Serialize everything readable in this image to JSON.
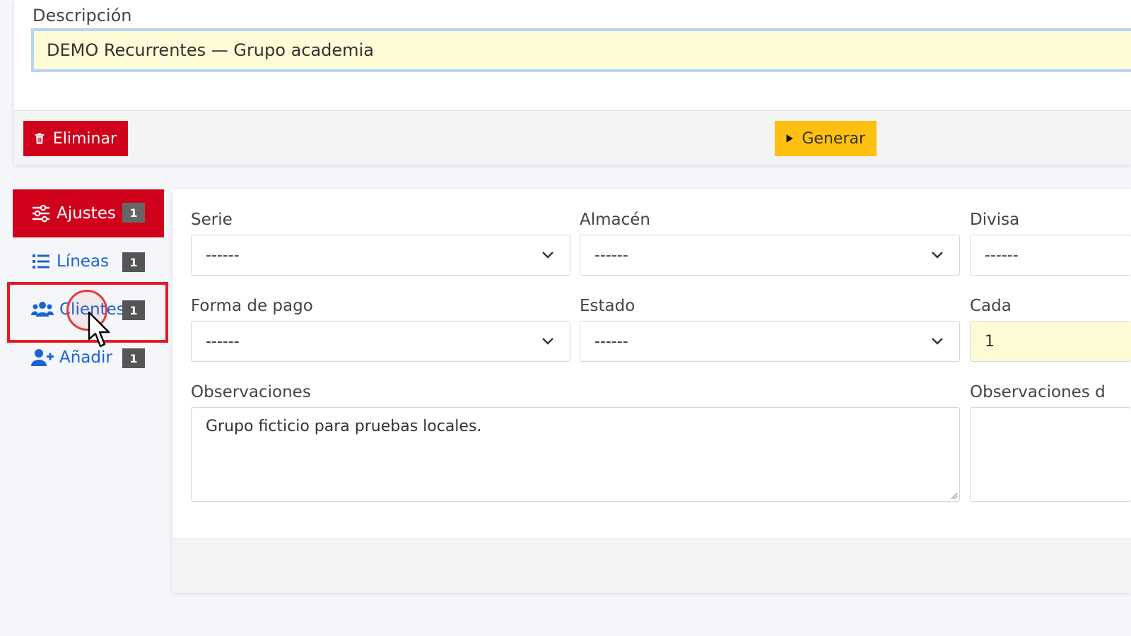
{
  "description": {
    "label": "Descripción",
    "value": "DEMO Recurrentes — Grupo academia"
  },
  "actions": {
    "delete_label": "Eliminar",
    "generate_label": "Generar"
  },
  "sidebar": {
    "items": [
      {
        "label": "Ajustes",
        "badge": "1",
        "icon": "sliders-icon",
        "active": true
      },
      {
        "label": "Líneas",
        "badge": "1",
        "icon": "list-icon",
        "active": false
      },
      {
        "label": "Clientes",
        "badge": "1",
        "icon": "users-icon",
        "active": false
      },
      {
        "label": "Añadir",
        "badge": "1",
        "icon": "user-plus-icon",
        "active": false
      }
    ]
  },
  "form": {
    "serie": {
      "label": "Serie",
      "value": "------"
    },
    "almacen": {
      "label": "Almacén",
      "value": "------"
    },
    "divisa": {
      "label": "Divisa",
      "value": "------"
    },
    "forma_pago": {
      "label": "Forma de pago",
      "value": "------"
    },
    "estado": {
      "label": "Estado",
      "value": "------"
    },
    "cada": {
      "label": "Cada",
      "value": "1"
    },
    "observaciones": {
      "label": "Observaciones",
      "value": "Grupo ficticio para pruebas locales."
    },
    "observaciones_d": {
      "label": "Observaciones d",
      "value": ""
    }
  },
  "colors": {
    "danger": "#d0021b",
    "warning": "#fdc010",
    "link": "#1a62d6",
    "highlight": "#e51b24",
    "input_fill": "#fdfcd6"
  }
}
